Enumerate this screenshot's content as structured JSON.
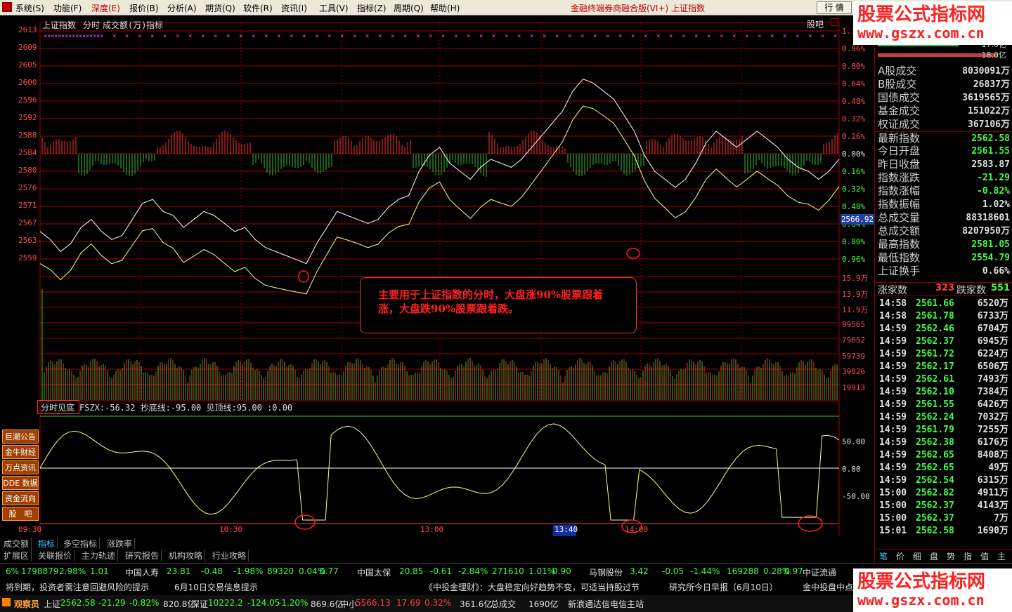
{
  "menu": {
    "items": [
      "系统(S)",
      "功能(F)",
      "深度(E)",
      "报价(B)",
      "分析(A)",
      "期货(Q)",
      "软件(R)",
      "资讯(I)",
      "工具(V)",
      "指标(Z)",
      "周期(Q)",
      "帮助(H)"
    ],
    "app_title": "金融终端券商融合版(VI+) 上证指数",
    "btn_quote": "行 情"
  },
  "chart": {
    "title": "上证指数",
    "view": "分时",
    "vol": "成交额(万)",
    "indicator": "指标",
    "guba": "股吧",
    "left_prices": [
      "2613",
      "2609",
      "2605",
      "2600",
      "2596",
      "2592",
      "2588",
      "2584",
      "2580",
      "2576",
      "2571",
      "2567",
      "2563",
      "2559"
    ],
    "right_pcts": [
      "1.1",
      "0.96%",
      "0.80%",
      "0.64%",
      "0.48%",
      "0.32%",
      "0.16%",
      "0.00%",
      "0.16%",
      "0.32%",
      "0.48%",
      "0.64%",
      "0.80%",
      "0.96%"
    ],
    "current_price": "2566.92",
    "vol_labels": [
      "15.9万",
      "13.9万",
      "11.9万",
      "99565",
      "79652",
      "59739",
      "39826",
      "19913"
    ],
    "annotation": "主要用于上证指数的分时，大盘涨90%股票跟着涨，大盘跌90%股票跟着跌。",
    "indicator_label": "分时见底",
    "indicator_values": "FSZX:-56.32  抄底线:-95.00  见顶线:95.00  :0.00",
    "ind_axis": [
      "50.00",
      "0.00",
      "-50.00"
    ],
    "time_labels": [
      "09:30",
      "10:30",
      "13:00",
      "13:40",
      "14:00"
    ]
  },
  "chart_data": {
    "type": "line",
    "title": "上证指数",
    "ylim": [
      2555,
      2615
    ],
    "prev_close": 2583.87,
    "series": [
      {
        "name": "上证指数",
        "values": [
          2565,
          2563,
          2560,
          2562,
          2566,
          2568,
          2565,
          2563,
          2564,
          2568,
          2572,
          2573,
          2570,
          2569,
          2566,
          2568,
          2570,
          2569,
          2567,
          2565,
          2566,
          2563,
          2561,
          2560,
          2559,
          2558,
          2557,
          2562,
          2566,
          2570,
          2569,
          2568,
          2567,
          2568,
          2571,
          2573,
          2574,
          2580,
          2584,
          2586,
          2582,
          2580,
          2578,
          2581,
          2583,
          2582,
          2581,
          2583,
          2586,
          2589,
          2592,
          2595,
          2600,
          2603,
          2602,
          2600,
          2598,
          2594,
          2590,
          2584,
          2580,
          2578,
          2576,
          2578,
          2582,
          2587,
          2590,
          2588,
          2586,
          2588,
          2590,
          2588,
          2586,
          2583,
          2581,
          2580,
          2578,
          2580,
          2583
        ]
      }
    ]
  },
  "left_buttons": [
    "巨潮公告",
    "金牛财经",
    "万点资讯",
    "DDE 数据",
    "资金流向",
    "股　吧"
  ],
  "sidebar": {
    "bars": [
      "17.0亿",
      "18.0亿"
    ],
    "rows": [
      {
        "k": "A股成交",
        "v": "8030091万",
        "c": "#e0e0e0"
      },
      {
        "k": "B股成交",
        "v": "26837万",
        "c": "#e0e0e0"
      },
      {
        "k": "国债成交",
        "v": "3619565万",
        "c": "#e0e0e0"
      },
      {
        "k": "基金成交",
        "v": "151022万",
        "c": "#e0e0e0"
      },
      {
        "k": "权证成交",
        "v": "367106万",
        "c": "#e0e0e0"
      },
      {
        "k": "最新指数",
        "v": "2562.58",
        "c": "#40ff40"
      },
      {
        "k": "今日开盘",
        "v": "2561.55",
        "c": "#40ff40"
      },
      {
        "k": "昨日收盘",
        "v": "2583.87",
        "c": "#e0e0e0"
      },
      {
        "k": "指数涨跌",
        "v": "-21.29",
        "c": "#40ff40"
      },
      {
        "k": "指数涨幅",
        "v": "-0.82%",
        "c": "#40ff40"
      },
      {
        "k": "指数振幅",
        "v": "1.02%",
        "c": "#e0e0e0"
      },
      {
        "k": "总成交量",
        "v": "88318601",
        "c": "#e0e0e0"
      },
      {
        "k": "总成交额",
        "v": "8207950万",
        "c": "#e0e0e0"
      },
      {
        "k": "最高指数",
        "v": "2581.05",
        "c": "#40ff40"
      },
      {
        "k": "最低指数",
        "v": "2554.79",
        "c": "#40ff40"
      },
      {
        "k": "上证换手",
        "v": "0.66%",
        "c": "#e0e0e0"
      }
    ],
    "up_label": "涨家数",
    "up": "323",
    "down_label": "跌家数",
    "down": "551",
    "ticks": [
      [
        "14:58",
        "2561.66",
        "6520万"
      ],
      [
        "14:58",
        "2561.78",
        "6733万"
      ],
      [
        "14:59",
        "2562.46",
        "6704万"
      ],
      [
        "14:59",
        "2562.37",
        "6945万"
      ],
      [
        "14:59",
        "2561.72",
        "6224万"
      ],
      [
        "14:59",
        "2562.17",
        "6506万"
      ],
      [
        "14:59",
        "2562.61",
        "7493万"
      ],
      [
        "14:59",
        "2562.10",
        "7384万"
      ],
      [
        "14:59",
        "2561.55",
        "6426万"
      ],
      [
        "14:59",
        "2562.24",
        "7032万"
      ],
      [
        "14:59",
        "2561.79",
        "7255万"
      ],
      [
        "14:59",
        "2562.38",
        "6176万"
      ],
      [
        "14:59",
        "2562.65",
        "8408万"
      ],
      [
        "14:59",
        "2562.65",
        "49万"
      ],
      [
        "14:59",
        "2562.54",
        "6315万"
      ],
      [
        "15:00",
        "2562.82",
        "4911万"
      ],
      [
        "15:00",
        "2562.37",
        "4143万"
      ],
      [
        "15:00",
        "2562.37",
        "7万"
      ],
      [
        "15:01",
        "2562.58",
        "1690万"
      ]
    ],
    "bottom_tabs": [
      "笔",
      "价",
      "细",
      "盘",
      "势",
      "指",
      "值",
      "主"
    ]
  },
  "tabs1": [
    "成交额",
    "指标",
    "多空指标",
    "涨跌率"
  ],
  "tabs2": [
    "扩展区",
    "关联报价",
    "主力轨迹",
    "研究报告",
    "机构攻略",
    "行业攻略"
  ],
  "ticker": [
    {
      "t": "6%",
      "c": "#40ff40"
    },
    {
      "t": "1798879",
      "c": "#40ff40"
    },
    {
      "t": "2.98%",
      "c": "#40ff40"
    },
    {
      "t": "1.01",
      "c": "#40ff40"
    },
    {
      "t": "中国人寿",
      "c": "#e0e0e0"
    },
    {
      "t": "23.81",
      "c": "#40ff40"
    },
    {
      "t": "-0.48",
      "c": "#40ff40"
    },
    {
      "t": "-1.98%",
      "c": "#40ff40"
    },
    {
      "t": "89320",
      "c": "#40ff40"
    },
    {
      "t": "0.04%",
      "c": "#40ff40"
    },
    {
      "t": "0.77",
      "c": "#40ff40"
    },
    {
      "t": "中国太保",
      "c": "#e0e0e0"
    },
    {
      "t": "20.85",
      "c": "#40ff40"
    },
    {
      "t": "-0.61",
      "c": "#40ff40"
    },
    {
      "t": "-2.84%",
      "c": "#40ff40"
    },
    {
      "t": "271610",
      "c": "#40ff40"
    },
    {
      "t": "1.01%",
      "c": "#40ff40"
    },
    {
      "t": "0.90",
      "c": "#40ff40"
    },
    {
      "t": "马钢股份",
      "c": "#e0e0e0"
    },
    {
      "t": "3.42",
      "c": "#40ff40"
    },
    {
      "t": "-0.05",
      "c": "#40ff40"
    },
    {
      "t": "-1.44%",
      "c": "#40ff40"
    },
    {
      "t": "169288",
      "c": "#40ff40"
    },
    {
      "t": "0.28%",
      "c": "#40ff40"
    },
    {
      "t": "0.97",
      "c": "#40ff40"
    },
    {
      "t": "中证流通",
      "c": "#e0e0e0"
    }
  ],
  "news": [
    "将到期，投资者需注意回避风险的提示",
    "6月10日交易信息提示",
    "《中投金理财》：大盘稳定向好趋势不变，可适当持股过节",
    "研究所今日早报（6月10日）",
    "金中投盘中点"
  ],
  "status": {
    "observer": "观察员",
    "sh": "上证",
    "sh_v": "2562.58",
    "sh_c": "-21.29",
    "sh_p": "-0.82%",
    "sh_a": "820.8亿",
    "sz": "深证",
    "sz_v": "10222.2",
    "sz_c": "-124.05",
    "sz_p": "-1.20%",
    "sz_a": "869.6亿",
    "zx": "中小",
    "zx_v": "5566.13",
    "zx_c": "17.69",
    "zx_p": "0.32%",
    "zx_a": "361.6亿",
    "tot": "总成交",
    "tot_v": "1690亿",
    "srv": "新浪通达信电信主站"
  },
  "watermark": {
    "top": "股票公式指标网",
    "url": "www.gszx.com.cn"
  }
}
